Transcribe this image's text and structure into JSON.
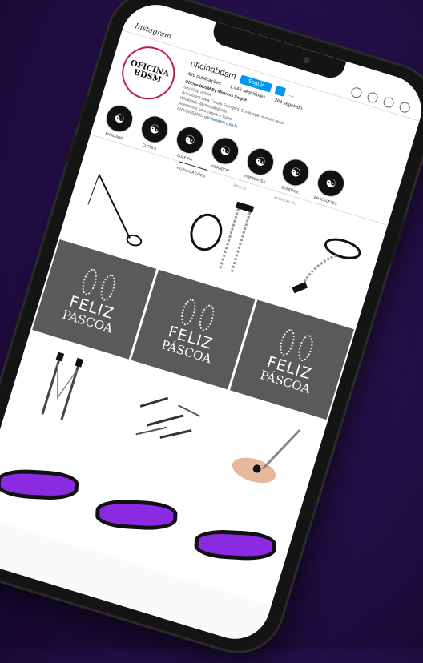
{
  "topbar": {
    "logo": "Instagram"
  },
  "profile": {
    "username": "oficinabdsm",
    "follow_label": "Seguir",
    "more": "...",
    "stats": [
      "486 publicações",
      "1.446 seguidores",
      "264 seguindo"
    ],
    "avatar_lines": [
      "OFICINA",
      "BDSM"
    ],
    "bio": {
      "name": "Oficina BDSM By Mistress Saigue",
      "lines": [
        "Sex shop online",
        "Acessórios para Casais Swingers, Dominação e muito mais",
        "Whatsapp: @oficinabdsmbr",
        "Acessórios para casais e Lojas",
        "ANIVERSÁRIO"
      ],
      "link": "oficinabdsm.com.br"
    }
  },
  "highlights": [
    {
      "label": "BONDAGE"
    },
    {
      "label": "CLOVES"
    },
    {
      "label": "COLEIRA"
    },
    {
      "label": "VIBRADOR"
    },
    {
      "label": "PRESENTES"
    },
    {
      "label": "BONDAGE"
    },
    {
      "label": "BRACELETES"
    }
  ],
  "tabs": [
    "PUBLICAÇÕES",
    "REELS",
    "MARCADOS"
  ],
  "posts": {
    "feliz": "FELIZ",
    "pascoa": "PÁSCOA"
  }
}
